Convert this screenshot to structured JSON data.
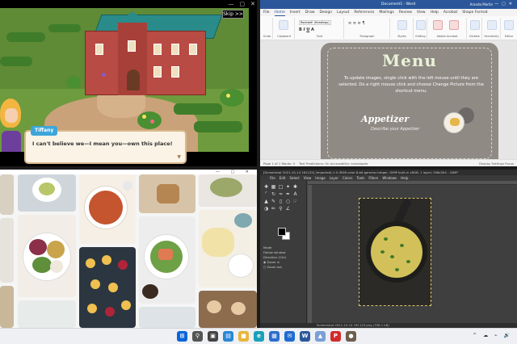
{
  "game": {
    "skip_label": "Skip",
    "skip_arrows": ">>",
    "speaker": "Tiffany",
    "dialog": "I can't believe we—I mean you—own this place!",
    "window_buttons": [
      "—",
      "▢",
      "✕"
    ]
  },
  "word": {
    "title": "Document1 - Word",
    "account": "Aranda Martin",
    "menu_tabs": [
      "File",
      "Home",
      "Insert",
      "Draw",
      "Design",
      "Layout",
      "References",
      "Mailings",
      "Review",
      "View",
      "Help",
      "Acrobat",
      "Shape Format"
    ],
    "active_tab": "Home",
    "ribbon_groups": [
      "Undo",
      "Clipboard",
      "Font",
      "Paragraph",
      "Styles",
      "Editing",
      "Adobe Acrobat",
      "Dictate",
      "Sensitivity",
      "Editor"
    ],
    "font_name": "Rockwell (Headings)",
    "doc": {
      "menu_title": "Menu",
      "instructions": "To update images, single click with the left mouse until they are selected. Do a right mouse click and choose Change Picture from the shortcut menu.",
      "section": "Appetizer",
      "section_sub": "Describe your Appetizer"
    },
    "status_left": "Page 1 of 1   Words: 0",
    "status_mid": "Text Predictions: On    Accessibility: Investigate",
    "status_right": "Display Settings   Focus"
  },
  "gallery": {
    "window_buttons": [
      "—",
      "▢",
      "✕"
    ]
  },
  "gimp": {
    "title": "[Screenshot 2021-10-14 161125] (imported)-1.0 (RGB color 8-bit gamma integer, GIMP built-in sRGB, 1 layer) 196x304 – GIMP",
    "menu": [
      "File",
      "Edit",
      "Select",
      "View",
      "Image",
      "Layer",
      "Colors",
      "Tools",
      "Filters",
      "Windows",
      "Help"
    ],
    "tool_options": [
      "Mode",
      "Follow window",
      "Direction (Ctrl)",
      "Zoom in",
      "Zoom out"
    ],
    "status": "Screenshot 2021-10-14 161125.png (338.1 kB)"
  },
  "taskbar": {
    "icons": [
      {
        "name": "start",
        "glyph": "⊞",
        "color": "#0a64d8"
      },
      {
        "name": "search",
        "glyph": "⚲",
        "color": "#555555"
      },
      {
        "name": "task-view",
        "glyph": "▣",
        "color": "#444444"
      },
      {
        "name": "widgets",
        "glyph": "▤",
        "color": "#2a86d6"
      },
      {
        "name": "file-explorer",
        "glyph": "■",
        "color": "#e8b63a"
      },
      {
        "name": "edge",
        "glyph": "e",
        "color": "#1ca0b8"
      },
      {
        "name": "store",
        "glyph": "▦",
        "color": "#2b6ecc"
      },
      {
        "name": "mail",
        "glyph": "✉",
        "color": "#1f6bd0"
      },
      {
        "name": "word",
        "glyph": "W",
        "color": "#2b579a"
      },
      {
        "name": "photos",
        "glyph": "▲",
        "color": "#7aa0d6"
      },
      {
        "name": "pinterest",
        "glyph": "P",
        "color": "#d12b2b"
      },
      {
        "name": "gimp",
        "glyph": "●",
        "color": "#6d5e4c"
      }
    ],
    "tray": "^ ☁ ⌁ 🔊"
  }
}
